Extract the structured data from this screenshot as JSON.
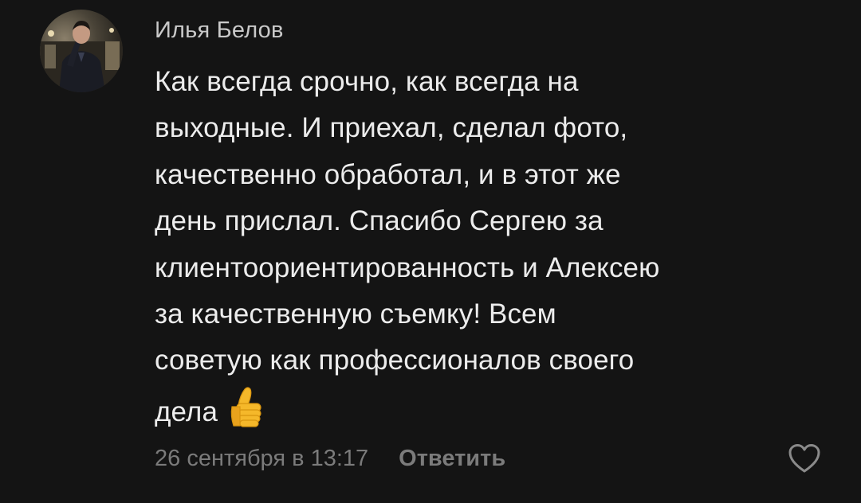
{
  "comment": {
    "author": "Илья Белов",
    "body_lines": [
      "Как всегда срочно, как всегда на",
      "выходные. И приехал, сделал фото,",
      "качественно обработал, и в этот же",
      "день прислал. Спасибо Сергею за",
      "клиентоориентированность и Алексею",
      "за качественную съемку!  Всем",
      "советую как профессионалов своего",
      "дела"
    ],
    "emoji": "thumbs-up",
    "timestamp": "26 сентября в 13:17",
    "reply_label": "Ответить",
    "like_icon": "heart-outline-icon"
  },
  "colors": {
    "background": "#141414",
    "text": "#ececec",
    "author": "#c9c9c9",
    "meta": "#7b7b7b",
    "emoji": "#f5b82a"
  }
}
